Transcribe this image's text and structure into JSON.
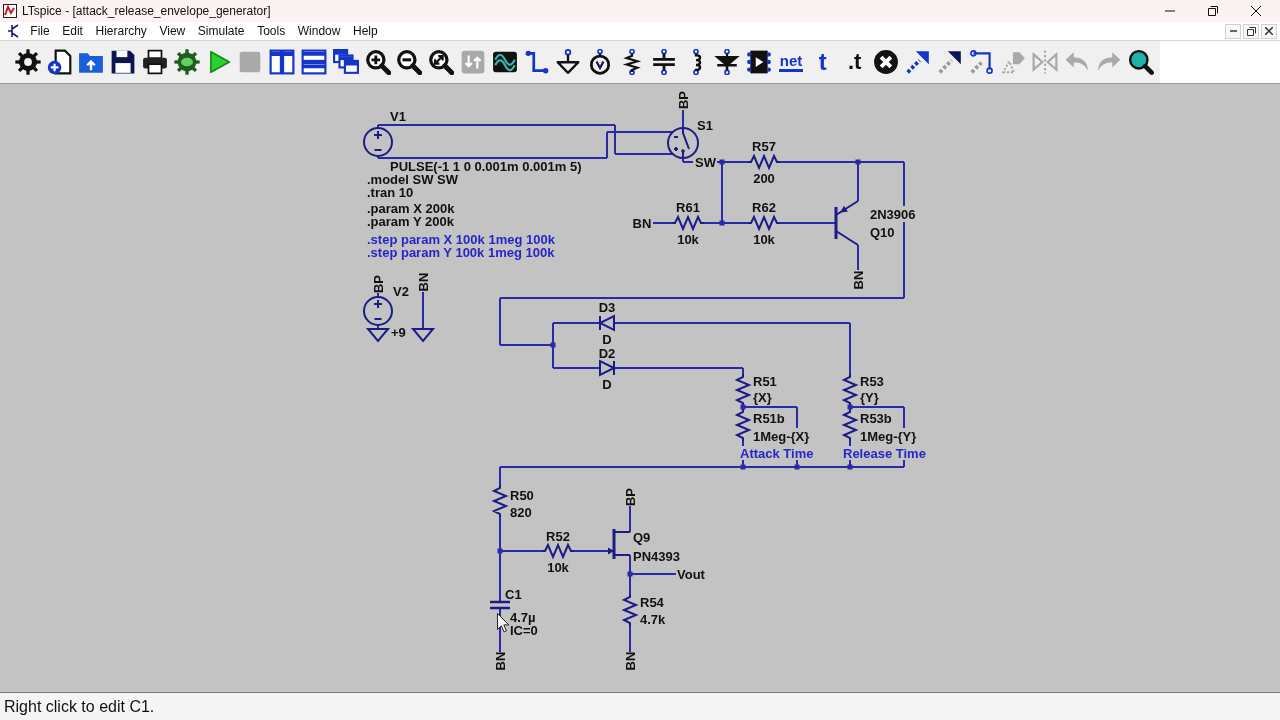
{
  "window": {
    "title": "LTspice - [attack_release_envelope_generator]"
  },
  "menu_bar": {
    "items": [
      "File",
      "Edit",
      "Hierarchy",
      "View",
      "Simulate",
      "Tools",
      "Window",
      "Help"
    ]
  },
  "toolbar": {
    "buttons": [
      {
        "disabled": false
      },
      {
        "disabled": false
      },
      {
        "disabled": false
      },
      {
        "disabled": false
      },
      {
        "disabled": false
      },
      {
        "disabled": false
      },
      {
        "disabled": false
      },
      {
        "disabled": true
      },
      {
        "disabled": false
      },
      {
        "disabled": false
      },
      {
        "disabled": false
      },
      {
        "disabled": false
      },
      {
        "disabled": false
      },
      {
        "disabled": false
      },
      {
        "disabled": true
      },
      {
        "disabled": false
      },
      {
        "disabled": false
      },
      {
        "disabled": false
      },
      {
        "disabled": false
      },
      {
        "disabled": false
      },
      {
        "disabled": false
      },
      {
        "disabled": false
      },
      {
        "disabled": false
      },
      {
        "disabled": false
      },
      {
        "label": "net",
        "disabled": false
      },
      {
        "label": "t",
        "disabled": false
      },
      {
        "label": ".t",
        "disabled": false
      },
      {
        "disabled": false
      },
      {
        "disabled": false
      },
      {
        "disabled": false
      },
      {
        "disabled": false
      },
      {
        "disabled": true
      },
      {
        "disabled": true
      },
      {
        "disabled": true
      },
      {
        "disabled": true
      },
      {
        "disabled": false
      }
    ]
  },
  "schematic": {
    "components": [
      {
        "kind": "voltage_source",
        "name": "V1",
        "value": "PULSE(-1 1 0 0.001m 0.001m 5)"
      },
      {
        "kind": "switch",
        "name": "S1",
        "value": "SW"
      },
      {
        "kind": "resistor",
        "name": "R57",
        "value": "200"
      },
      {
        "kind": "resistor",
        "name": "R61",
        "value": "10k"
      },
      {
        "kind": "resistor",
        "name": "R62",
        "value": "10k"
      },
      {
        "kind": "pnp",
        "name": "Q10",
        "value": "2N3906"
      },
      {
        "kind": "voltage_source",
        "name": "V2",
        "value": "+9"
      },
      {
        "kind": "diode",
        "name": "D3",
        "value": "D"
      },
      {
        "kind": "diode",
        "name": "D2",
        "value": "D"
      },
      {
        "kind": "resistor",
        "name": "R51",
        "value": "{X}"
      },
      {
        "kind": "resistor",
        "name": "R51b",
        "value": "1Meg-{X}"
      },
      {
        "kind": "resistor",
        "name": "R53",
        "value": "{Y}"
      },
      {
        "kind": "resistor",
        "name": "R53b",
        "value": "1Meg-{Y}"
      },
      {
        "kind": "resistor",
        "name": "R50",
        "value": "820"
      },
      {
        "kind": "resistor",
        "name": "R52",
        "value": "10k"
      },
      {
        "kind": "njf",
        "name": "Q9",
        "value": "PN4393"
      },
      {
        "kind": "resistor",
        "name": "R54",
        "value": "4.7k"
      },
      {
        "kind": "capacitor",
        "name": "C1",
        "value": "4.7µ",
        "extra": "IC=0"
      }
    ],
    "net_labels": [
      "BP",
      "BN",
      "BN",
      "BP",
      "BN",
      "BP",
      "BN",
      "BN",
      "Vout"
    ],
    "directives": [
      {
        "text": ".model SW SW",
        "commented": false
      },
      {
        "text": ".tran 10",
        "commented": false
      },
      {
        "text": ".param X 200k",
        "commented": false
      },
      {
        "text": ".param Y 200k",
        "commented": false
      },
      {
        "text": ".step param X 100k 1meg 100k",
        "commented": true
      },
      {
        "text": ".step param Y 100k 1meg 100k",
        "commented": true
      }
    ],
    "comments": [
      "Attack Time",
      "Release Time"
    ]
  },
  "status_bar": {
    "text": "Right click to edit C1."
  }
}
